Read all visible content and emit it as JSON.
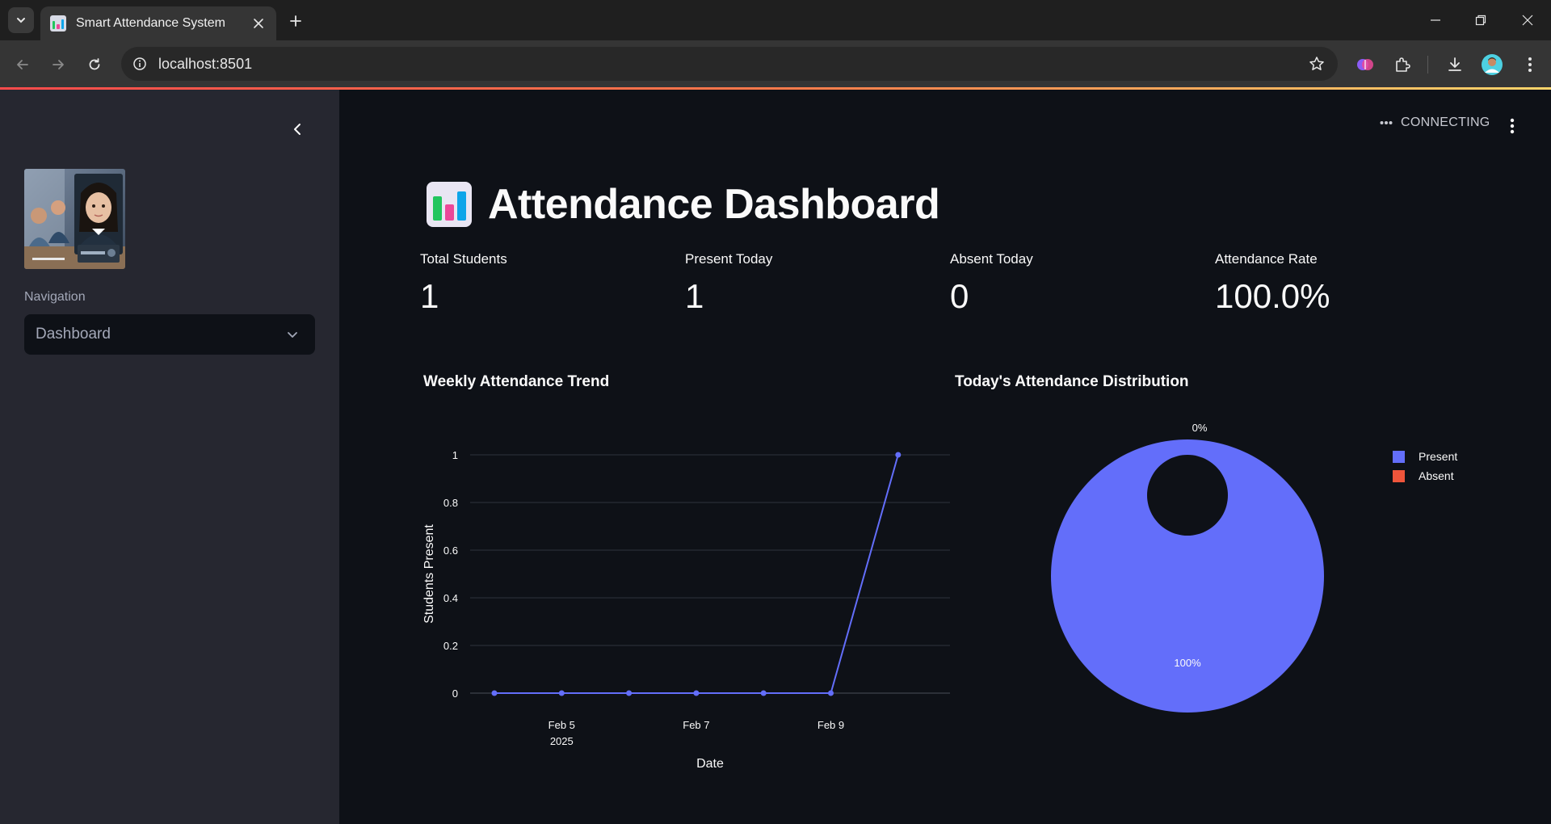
{
  "browser": {
    "tab_title": "Smart Attendance System",
    "url": "localhost:8501"
  },
  "sidebar": {
    "nav_label": "Navigation",
    "selected_page": "Dashboard"
  },
  "header": {
    "status": "CONNECTING"
  },
  "page": {
    "title": "Attendance Dashboard"
  },
  "metrics": [
    {
      "label": "Total Students",
      "value": "1"
    },
    {
      "label": "Present Today",
      "value": "1"
    },
    {
      "label": "Absent Today",
      "value": "0"
    },
    {
      "label": "Attendance Rate",
      "value": "100.0%"
    }
  ],
  "colors": {
    "accent": "#636efa",
    "absent": "#ef553b",
    "progress_start": "#ff4b4b",
    "progress_end": "#ffd56b"
  },
  "chart_data": [
    {
      "type": "line",
      "title": "Weekly Attendance Trend",
      "xlabel": "Date",
      "ylabel": "Students Present",
      "x": [
        "2025-02-04",
        "2025-02-05",
        "2025-02-06",
        "2025-02-07",
        "2025-02-08",
        "2025-02-09",
        "2025-02-10"
      ],
      "series": [
        {
          "values": [
            0,
            0,
            0,
            0,
            0,
            0,
            1
          ]
        }
      ],
      "x_ticks": [
        {
          "date": "2025-02-05",
          "label": "Feb 5",
          "sublabel": "2025"
        },
        {
          "date": "2025-02-07",
          "label": "Feb 7",
          "sublabel": ""
        },
        {
          "date": "2025-02-09",
          "label": "Feb 9",
          "sublabel": ""
        }
      ],
      "y_ticks": [
        0,
        0.2,
        0.4,
        0.6,
        0.8,
        1
      ],
      "ylim": [
        0,
        1
      ],
      "grid": true
    },
    {
      "type": "pie",
      "title": "Today's Attendance Distribution",
      "donut": true,
      "slices": [
        {
          "label": "Present",
          "value": 1,
          "text": "100%",
          "color": "#636efa"
        },
        {
          "label": "Absent",
          "value": 0,
          "text": "0%",
          "color": "#ef553b"
        }
      ],
      "legend_position": "top-right"
    }
  ]
}
